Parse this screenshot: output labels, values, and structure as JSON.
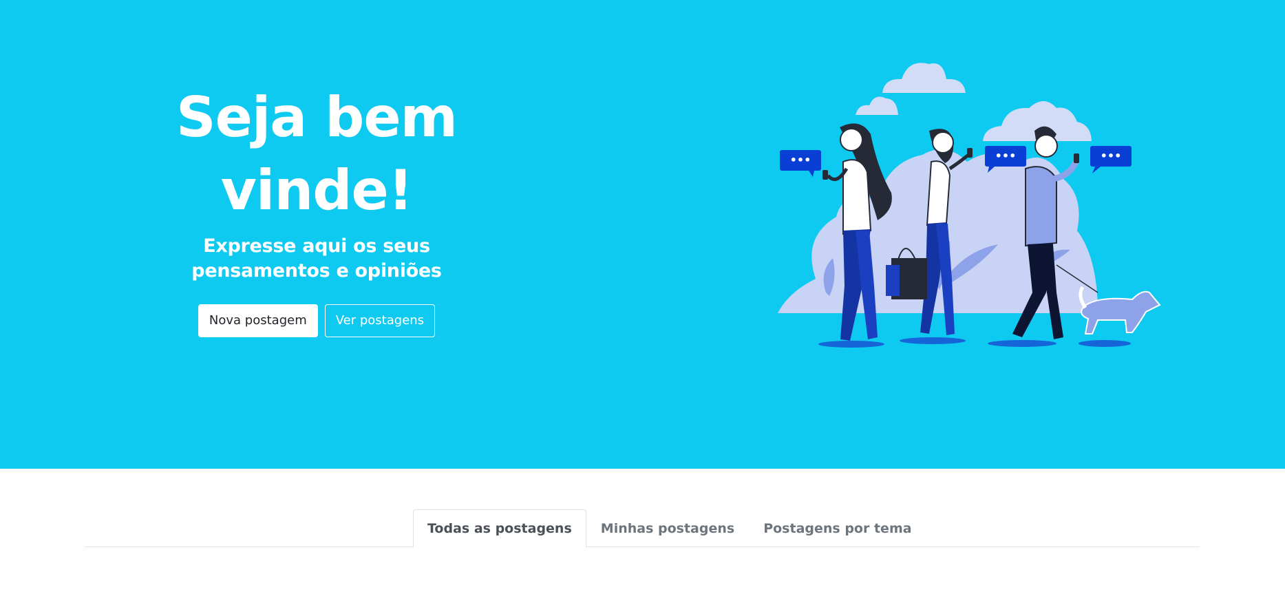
{
  "hero": {
    "title_line1": "Seja bem",
    "title_line2": "vinde!",
    "subtitle_line1": "Expresse aqui os seus",
    "subtitle_line2": "pensamentos e opiniões",
    "buttons": {
      "new_post": "Nova postagem",
      "view_posts": "Ver postagens"
    },
    "illustration": {
      "name": "people-walking-with-phones-illustration",
      "speech_bubble_text": "•••"
    }
  },
  "tabs": [
    {
      "label": "Todas as postagens",
      "active": true
    },
    {
      "label": "Minhas postagens",
      "active": false
    },
    {
      "label": "Postagens por tema",
      "active": false
    }
  ],
  "colors": {
    "hero_background": "#0fcaf0",
    "bubble_blue": "#0a3fd6",
    "clothing_blue": "#1434a4",
    "foliage_lavender": "#c9d3f5",
    "tab_border": "#dee2e6",
    "tab_text": "#6c757d"
  }
}
